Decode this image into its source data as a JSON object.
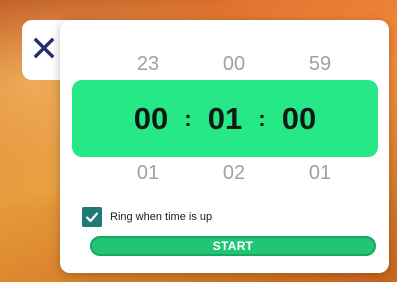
{
  "close_icon": "close-icon",
  "picker": {
    "above": [
      "23",
      "00",
      "59"
    ],
    "hours": "00",
    "minutes": "01",
    "seconds": "00",
    "separator": ":",
    "below": [
      "01",
      "02",
      "01"
    ]
  },
  "options": {
    "ring_label": "Ring when time is up",
    "ring_checked": true
  },
  "start_label": "START",
  "colors": {
    "accent": "#26e887",
    "start_button": "#22c476",
    "checkbox": "#1f7a76",
    "muted_digits": "#9aa3a8"
  }
}
